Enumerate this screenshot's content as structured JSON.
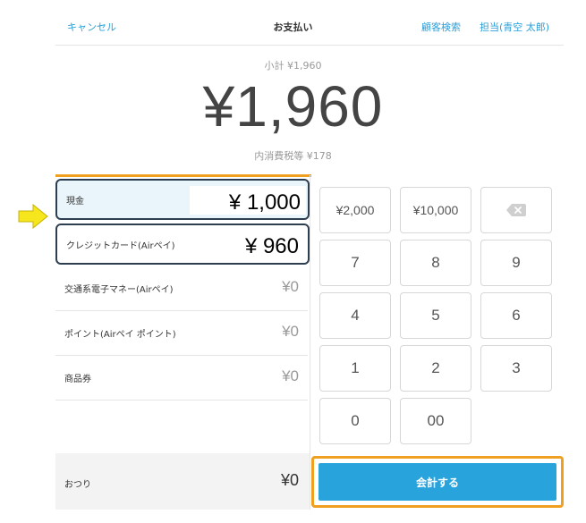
{
  "header": {
    "cancel": "キャンセル",
    "title": "お支払い",
    "customer_search": "顧客検索",
    "staff": "担当(青空 太郎)"
  },
  "totals": {
    "subtotal": "小計 ¥1,960",
    "total": "¥1,960",
    "tax": "内消費税等 ¥178"
  },
  "payments": [
    {
      "label": "現金",
      "amount": "¥ 1,000"
    },
    {
      "label": "クレジットカード(Airペイ)",
      "amount": "¥ 960"
    },
    {
      "label": "交通系電子マネー(Airペイ)",
      "amount": "¥0"
    },
    {
      "label": "ポイント(Airペイ ポイント)",
      "amount": "¥0"
    },
    {
      "label": "商品券",
      "amount": "¥0"
    }
  ],
  "change": {
    "label": "おつり",
    "amount": "¥0"
  },
  "keypad": {
    "k2000": "¥2,000",
    "k10000": "¥10,000",
    "k7": "7",
    "k8": "8",
    "k9": "9",
    "k4": "4",
    "k5": "5",
    "k6": "6",
    "k1": "1",
    "k2": "2",
    "k3": "3",
    "k0": "0",
    "k00": "00"
  },
  "checkout": {
    "label": "会計する"
  },
  "colors": {
    "accent": "#29a3dc",
    "highlight": "#f0a020",
    "link": "#2a9fd8",
    "arrow": "#f5e61d"
  }
}
